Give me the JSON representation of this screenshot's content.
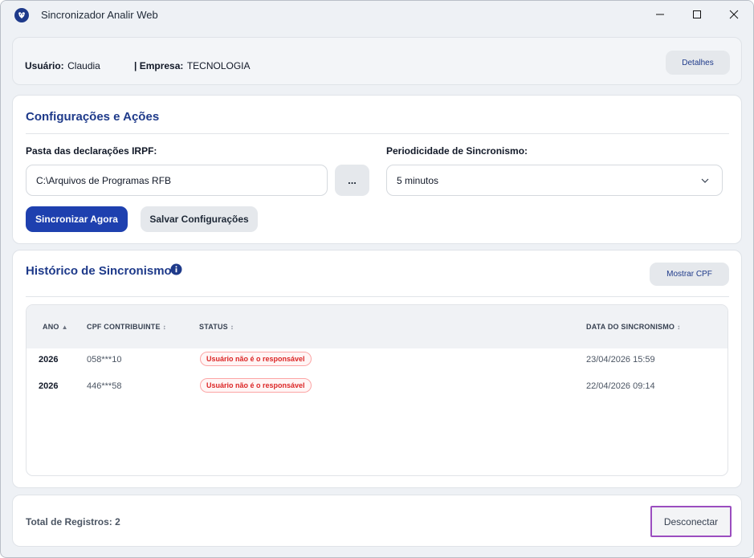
{
  "window": {
    "title": "Sincronizador Analir Web",
    "controls": {
      "minimize": "minimize-icon",
      "maximize": "maximize-icon",
      "close": "close-icon"
    }
  },
  "header": {
    "user_label": "Usuário:",
    "user_value": "Claudia",
    "company_label": "| Empresa:",
    "company_value": "TECNOLOGIA",
    "details_button": "Detalhes"
  },
  "config": {
    "title": "Configurações e Ações",
    "folder_label": "Pasta das declarações IRPF:",
    "folder_value": "C:\\Arquivos de Programas RFB",
    "browse_button": "...",
    "period_label": "Periodicidade de Sincronismo:",
    "period_value": "5 minutos",
    "sync_button": "Sincronizar Agora",
    "save_button": "Salvar Configurações"
  },
  "history": {
    "title": "Histórico de Sincronismo",
    "show_cpf_button": "Mostrar CPF",
    "columns": {
      "year": "ANO",
      "cpf": "CPF CONTRIBUINTE",
      "status": "STATUS",
      "date": "DATA DO SINCRONISMO"
    },
    "rows": [
      {
        "year": "2026",
        "cpf": "058***10",
        "status": "Usuário não é o responsável",
        "date": "23/04/2026 15:59"
      },
      {
        "year": "2026",
        "cpf": "446***58",
        "status": "Usuário não é o responsável",
        "date": "22/04/2026 09:14"
      }
    ]
  },
  "footer": {
    "total_label": "Total de Registros: 2",
    "disconnect_button": "Desconectar"
  },
  "colors": {
    "accent": "#1e3a8a",
    "primary_button": "#1e40af",
    "error_text": "#dc2626",
    "focus_outline": "#9b4dbf"
  }
}
